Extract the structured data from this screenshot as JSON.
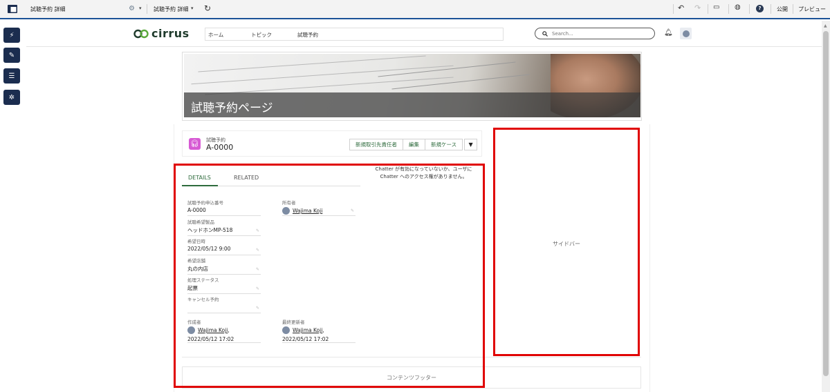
{
  "topbar": {
    "page_label": "試聴予約 詳細",
    "page_label_2": "試聴予約 詳細",
    "publish_label": "公開",
    "preview_label": "プレビュー",
    "help_glyph": "?"
  },
  "header": {
    "logo_text": "cirrus",
    "nav_items": [
      "ホーム",
      "トピック",
      "試聴予約"
    ],
    "search_placeholder": "Search..."
  },
  "banner": {
    "title": "試聴予約ページ"
  },
  "record": {
    "object_type": "試聴予約",
    "name": "A-0000",
    "buttons": [
      "新規取引先責任者",
      "編集",
      "新規ケース"
    ]
  },
  "tabs": [
    "DETAILS",
    "RELATED"
  ],
  "chatter_message": "Chatter が有効になっていないか、ユーザに Chatter へのアクセス権がありません。",
  "fields_left": [
    {
      "label": "試聴予約申込番号",
      "value": "A-0000"
    },
    {
      "label": "試聴希望製品",
      "value": "ヘッドホンMP-518"
    },
    {
      "label": "希望日時",
      "value": "2022/05/12 9:00"
    },
    {
      "label": "希望店舗",
      "value": "丸の内店"
    },
    {
      "label": "処理ステータス",
      "value": "起票"
    },
    {
      "label": "キャンセル予約",
      "value": ""
    }
  ],
  "owner": {
    "label": "所有者",
    "user": "Wajima Koji"
  },
  "created": {
    "label": "作成者",
    "user": "Wajima Koji",
    "suffix": ",",
    "timestamp": "2022/05/12 17:02"
  },
  "modified": {
    "label": "最終更新者",
    "user": "Wajima Koji",
    "suffix": ",",
    "timestamp": "2022/05/12 17:02"
  },
  "sidebar_label": "サイドバー",
  "footer_label": "コンテンツフッター",
  "colors": {
    "accent_green": "#2e6b3d",
    "rail_navy": "#1b2d4f",
    "highlight_red": "#e00000",
    "record_icon": "#d75ad4"
  },
  "icons": {
    "app": "app-layout-icon",
    "gear": "gear-icon",
    "refresh": "refresh-icon",
    "undo": "undo-icon",
    "redo": "redo-icon",
    "desktop": "desktop-icon",
    "globe": "globe-icon",
    "help": "help-icon",
    "rail": [
      "lightning-icon",
      "brush-icon",
      "list-icon",
      "gear-icon"
    ],
    "search": "search-icon",
    "bell": "bell-icon",
    "record": "headphones-icon"
  }
}
